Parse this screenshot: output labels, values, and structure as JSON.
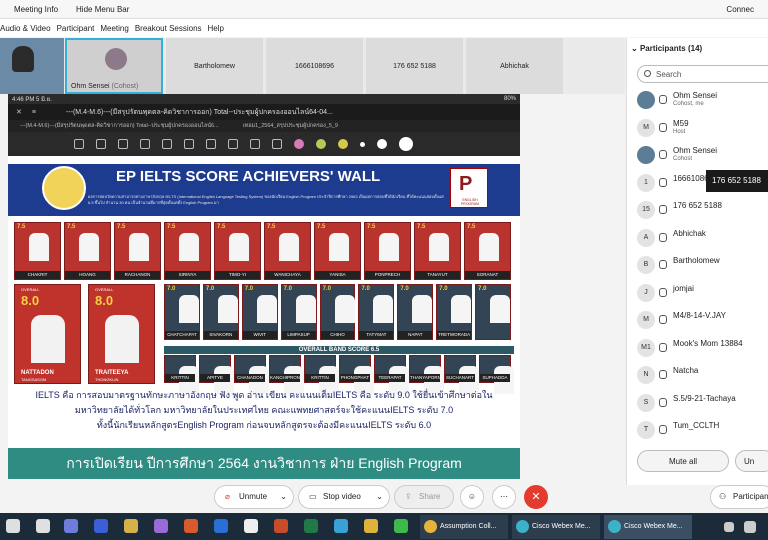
{
  "topbar": {
    "meeting_info": "Meeting Info",
    "hide_menu": "Hide Menu Bar",
    "connect": "Connec"
  },
  "menu": [
    "Audio & Video",
    "Participant",
    "Meeting",
    "Breakout Sessions",
    "Help"
  ],
  "strip": {
    "self_name": "Ohm Sensei",
    "self_role": "(Cohost)",
    "tiles": [
      "Bartholomew",
      "1666108696",
      "176 652 5188",
      "Abhichak"
    ]
  },
  "share": {
    "time": "4:46 PM  5 มิ.ย.",
    "battery": "80%",
    "doc_title": "---(M.4-M.6)---(มีสรุปรัตนพุดตล-คิดวิชาการออก) Total--ประชุมผู้ปกครองออนไลน์64-04...",
    "tab1": "---(M.4-M.6)---(มีสรุปรัตนพุดตล-คิดวิชาการออก) Total--ประชุมผู้ปกครองออนไลน์6...",
    "tab2": "เทอม1_2564_สรุปประชุมผู้ปกครอง_5_9"
  },
  "poster": {
    "title": "EP IELTS SCORE ACHIEVERS' WALL",
    "desc": "ผลการสอบวัดความสามารถทางภาษาอังกฤษ IELTS (International English Language Testing System) ของนักเรียน English Program ประจำปีการศึกษา 2563 เป็นผลการสอบที่ได้นักเรียน ที่ได้คะแนนสอบตั้งแต่ 6.5 ขึ้นไป จำนวน 30 คน เป็นจำนวนที่มากที่สุดตั้งแต่ตั้ง English Program มา",
    "logo_letter": "P",
    "logo_sub": "ENGLISH PROGRAM",
    "row1_scores": [
      "7.5",
      "7.5",
      "7.5",
      "7.5",
      "7.5",
      "7.5",
      "7.5",
      "7.5",
      "7.5",
      "7.5"
    ],
    "row1_names": [
      "CHAKRIT",
      "HOANG",
      "RACHANON",
      "SIRINYA",
      "TIMO-YI",
      "WANICHAYA",
      "YANISA",
      "PONPRECH",
      "TANAYUT",
      "SORANAT"
    ],
    "overall_label": "OVERALL",
    "big1_score": "8.0",
    "big1_first": "NATTADON",
    "big1_last": "TANGSASOM",
    "big2_score": "8.0",
    "big2_first": "TRAITEEYA",
    "big2_last": "THONGKLIN",
    "row2_scores": [
      "7.0",
      "7.0",
      "7.0",
      "7.0",
      "7.0",
      "7.0",
      "7.0",
      "7.0",
      "7.0"
    ],
    "row2_names": [
      "CHATCHAPAT",
      "SIVAKORN",
      "WIVIT",
      "LIMPASUP",
      "CHIHO",
      "TATYMAT",
      "NAPAT",
      "TRETWORADA"
    ],
    "band_label": "OVERALL BAND SCORE 6.5",
    "row3_names": [
      "KRITTIN",
      "APITYE",
      "CHANADON",
      "KANCHIPRON",
      "KRITTIN",
      "PHONGPHAT",
      "TEERAPAT",
      "THANYAPORN",
      "SUCHANART",
      "SUPHADDA"
    ],
    "thai_line1": "IELTS คือ การสอบมาตรฐานทักษะภาษาอังกฤษ ฟัง พูด อ่าน เขียน คะแนนเต็มIELTS คือ ระดับ 9.0 ใช้ยื่นเข้าศึกษาต่อใน",
    "thai_line2": "มหาวิทยาลัยได้ทั่วโลก มหาวิทยาลัยในประเทศไทย คณะแพทยศาสตร์จะใช้คะแนนIELTS ระดับ 7.0",
    "thai_line3": "ทั้งนี้นักเรียนหลักสูตรEnglish Program ก่อนจบหลักสูตรจะต้องมีคะแนนIELTS ระดับ 6.0",
    "thai_footer": "การเปิดเรียน ปีการศึกษา 2564 งานวิชาการ ฝ่าย English Program"
  },
  "panel": {
    "title": "Participants (14)",
    "search_placeholder": "Search",
    "tooltip": "176 652 5188",
    "participants": [
      {
        "initials": "",
        "name": "Ohm Sensei",
        "role": "Cohost, me"
      },
      {
        "initials": "M",
        "name": "M59",
        "role": "Host"
      },
      {
        "initials": "",
        "name": "Ohm Sensei",
        "role": "Cohost"
      },
      {
        "initials": "1",
        "name": "16661086",
        "role": ""
      },
      {
        "initials": "15",
        "name": "176 652 5188",
        "role": ""
      },
      {
        "initials": "A",
        "name": "Abhichak",
        "role": ""
      },
      {
        "initials": "B",
        "name": "Bartholomew",
        "role": ""
      },
      {
        "initials": "J",
        "name": "jomjai",
        "role": ""
      },
      {
        "initials": "M",
        "name": "M4/8-14-V.JAY",
        "role": ""
      },
      {
        "initials": "M1",
        "name": "Mook's Mom 13884",
        "role": ""
      },
      {
        "initials": "N",
        "name": "Natcha",
        "role": ""
      },
      {
        "initials": "S",
        "name": "S.5/9-21-Tachaya",
        "role": ""
      },
      {
        "initials": "T",
        "name": "Tum_CCLTH",
        "role": ""
      }
    ],
    "mute_all": "Mute all",
    "unmute_all": "Un"
  },
  "controls": {
    "unmute": "Unmute",
    "stop_video": "Stop video",
    "share": "Share",
    "participants": "Participan"
  },
  "taskbar": {
    "apps": [
      "Assumption Coll...",
      "Cisco Webex Me...",
      "Cisco Webex Me..."
    ]
  },
  "colors": {
    "accent": "#1d3b8f",
    "leave": "#e33b2e",
    "footer": "#2e8c83"
  }
}
